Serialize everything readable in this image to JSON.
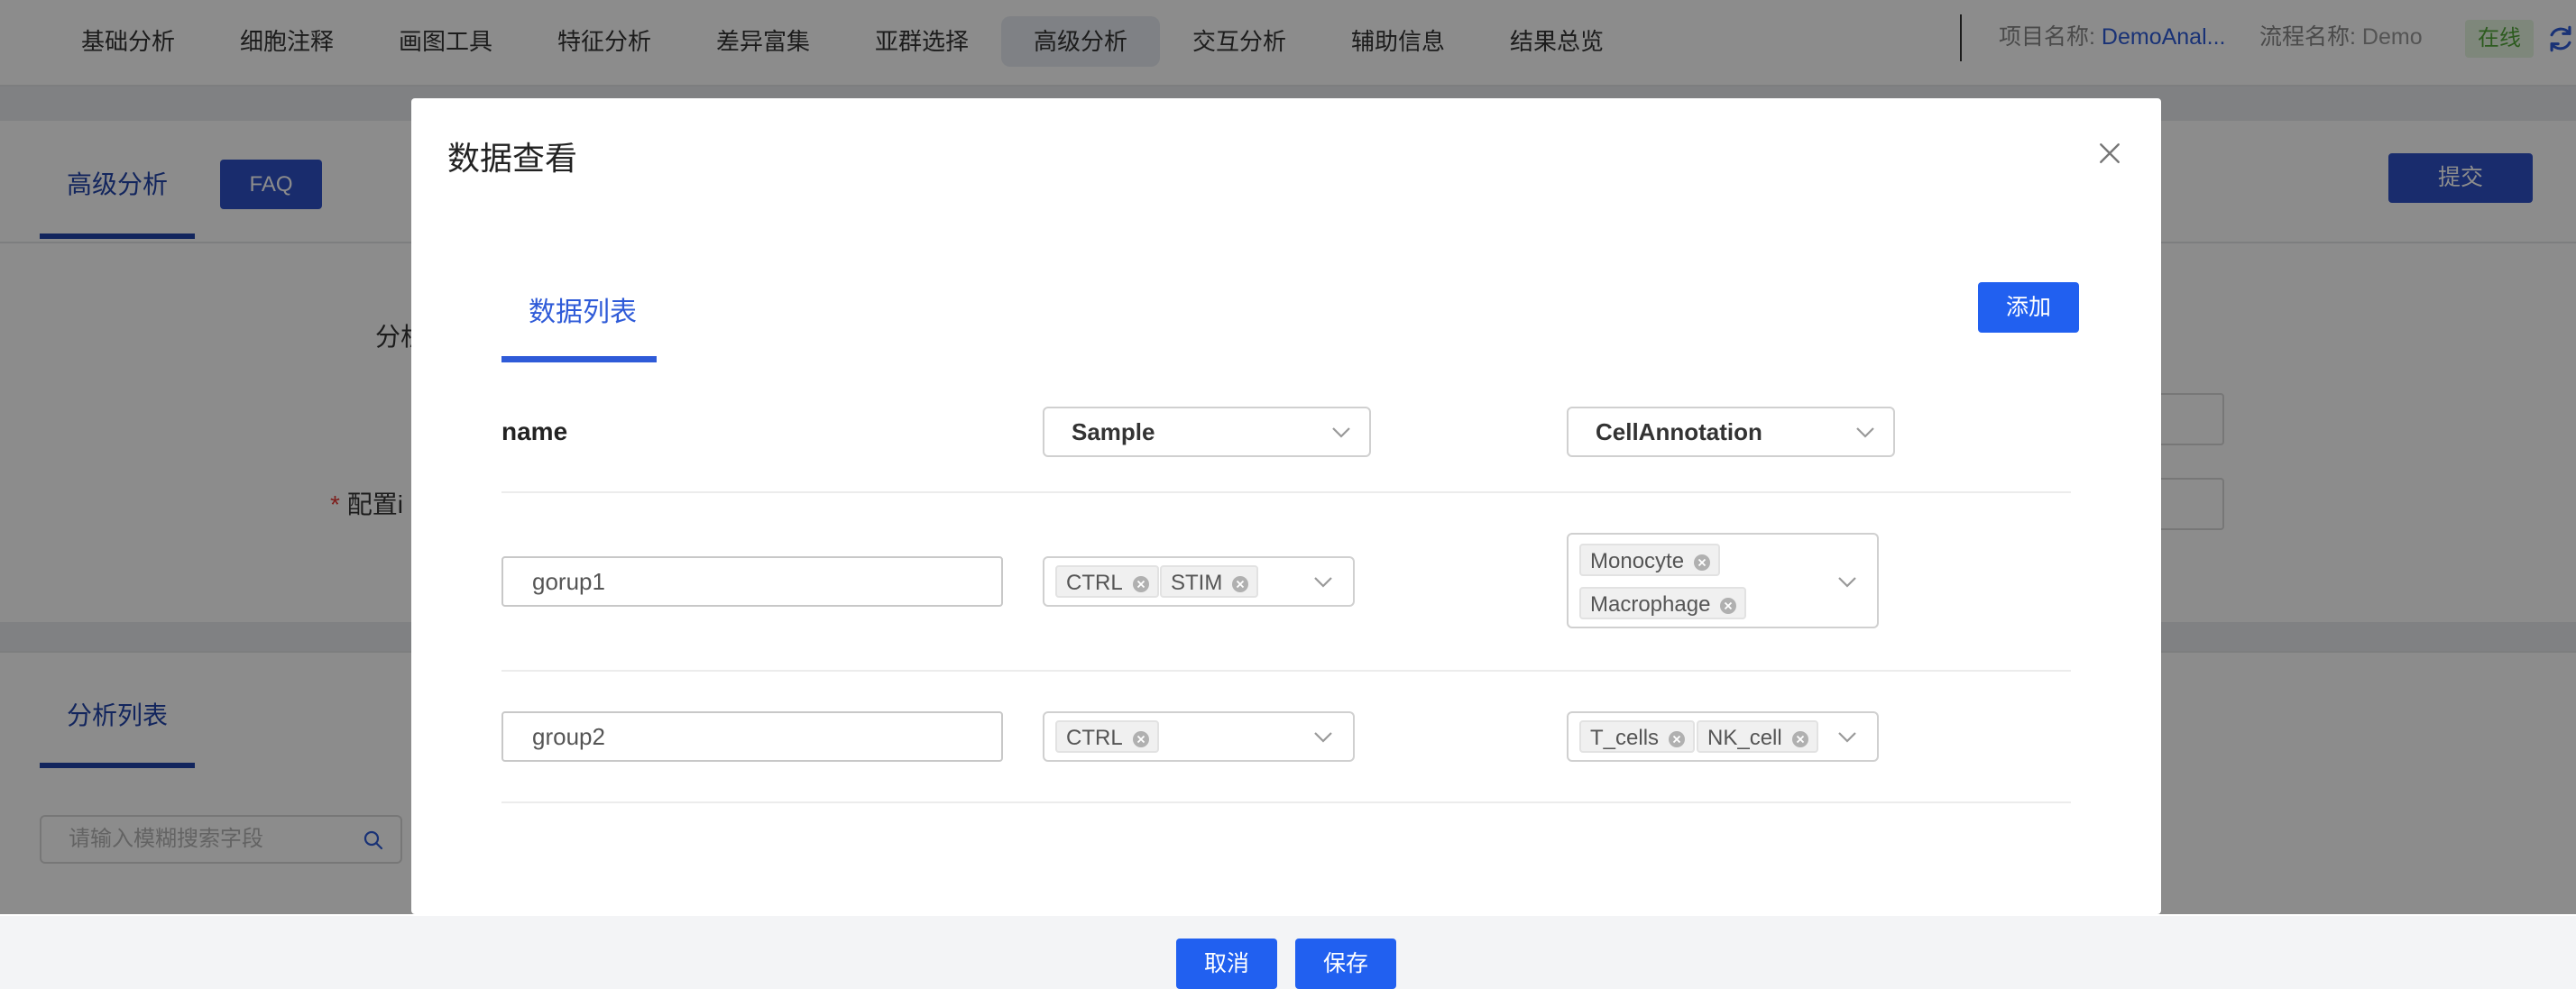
{
  "topnav": {
    "items": [
      "基础分析",
      "细胞注释",
      "画图工具",
      "特征分析",
      "差异富集",
      "亚群选择",
      "高级分析",
      "交互分析",
      "辅助信息",
      "结果总览"
    ],
    "active_index": 6,
    "project_label": "项目名称:",
    "project_value": "DemoAnal...",
    "flow_label": "流程名称:",
    "flow_value": "Demo",
    "status": "在线"
  },
  "page": {
    "tab_advanced": "高级分析",
    "faq_button": "FAQ",
    "submit_button": "提交",
    "label_analysis": "分析",
    "label_config": "配置i",
    "tab_analysis_list": "分析列表",
    "search_placeholder": "请输入模糊搜索字段"
  },
  "modal": {
    "title": "数据查看",
    "tab_label": "数据列表",
    "add_button": "添加",
    "header": {
      "name": "name",
      "column2_select": "Sample",
      "column3_select": "CellAnnotation"
    },
    "rows": [
      {
        "name": "gorup1",
        "samples": [
          "CTRL",
          "STIM"
        ],
        "annotations": [
          "Monocyte",
          "Macrophage"
        ]
      },
      {
        "name": "group2",
        "samples": [
          "CTRL"
        ],
        "annotations": [
          "T_cells",
          "NK_cell"
        ]
      }
    ],
    "cancel_button": "取消",
    "save_button": "保存"
  },
  "colors": {
    "primary": "#2160f0",
    "nav_accent": "#2f5bd8",
    "status_green": "#52a63a",
    "overlay": "rgba(0,0,0,0.45)"
  },
  "icons": [
    "refresh-icon",
    "search-icon",
    "close-icon",
    "chevron-down-icon",
    "tag-remove-icon"
  ]
}
